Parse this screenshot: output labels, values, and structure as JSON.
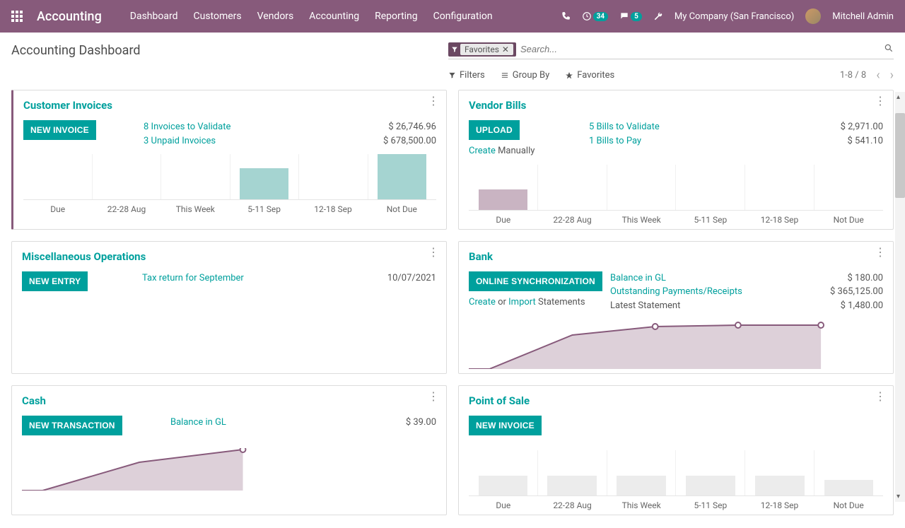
{
  "topbar": {
    "brand": "Accounting",
    "nav": [
      "Dashboard",
      "Customers",
      "Vendors",
      "Accounting",
      "Reporting",
      "Configuration"
    ],
    "activity_count": "34",
    "msg_count": "5",
    "company": "My Company (San Francisco)",
    "user": "Mitchell Admin"
  },
  "header": {
    "title": "Accounting Dashboard",
    "filter_tag": "Favorites",
    "search_placeholder": "Search...",
    "tools": {
      "filters": "Filters",
      "groupby": "Group By",
      "favorites": "Favorites"
    },
    "pager": "1-8 / 8"
  },
  "cards": {
    "ci": {
      "title": "Customer Invoices",
      "button": "NEW INVOICE",
      "line1": "8 Invoices to Validate",
      "amt1": "$ 26,746.96",
      "line2": "3 Unpaid Invoices",
      "amt2": "$ 678,500.00"
    },
    "vb": {
      "title": "Vendor Bills",
      "button": "UPLOAD",
      "sub_create": "Create",
      "sub_manual": " Manually",
      "line1": "5 Bills to Validate",
      "amt1": "$ 2,971.00",
      "line2": "1 Bills to Pay",
      "amt2": "$ 541.10"
    },
    "mo": {
      "title": "Miscellaneous Operations",
      "button": "NEW ENTRY",
      "line1": "Tax return for September",
      "amt1": "10/07/2021"
    },
    "bank": {
      "title": "Bank",
      "button": "ONLINE SYNCHRONIZATION",
      "sub_create": "Create",
      "sub_or": " or ",
      "sub_import": "Import",
      "sub_stmt": " Statements",
      "l1": "Balance in GL",
      "a1": "$ 180.00",
      "l2": "Outstanding Payments/Receipts",
      "a2": "$ 365,125.00",
      "l3": "Latest Statement",
      "a3": "$ 1,480.00"
    },
    "cash": {
      "title": "Cash",
      "button": "NEW TRANSACTION",
      "l1": "Balance in GL",
      "a1": "$ 39.00"
    },
    "pos": {
      "title": "Point of Sale",
      "button": "NEW INVOICE"
    }
  },
  "xcats": [
    "Due",
    "22-28 Aug",
    "This Week",
    "5-11 Sep",
    "12-18 Sep",
    "Not Due"
  ],
  "chart_data": [
    {
      "type": "bar",
      "card": "ci",
      "categories": [
        "Due",
        "22-28 Aug",
        "This Week",
        "5-11 Sep",
        "12-18 Sep",
        "Not Due"
      ],
      "values": [
        0,
        0,
        0,
        44,
        0,
        64
      ],
      "color": "teal"
    },
    {
      "type": "bar",
      "card": "vb",
      "categories": [
        "Due",
        "22-28 Aug",
        "This Week",
        "5-11 Sep",
        "12-18 Sep",
        "Not Due"
      ],
      "values": [
        28,
        0,
        0,
        0,
        0,
        0
      ],
      "color": "mauve"
    },
    {
      "type": "line",
      "card": "bank",
      "x": [
        "Due",
        "22-28 Aug",
        "This Week",
        "5-11 Sep",
        "12-18 Sep",
        "Not Due"
      ],
      "values": [
        0,
        48,
        60,
        62,
        62,
        62
      ]
    },
    {
      "type": "line",
      "card": "cash",
      "x": [
        "Due",
        "22-28 Aug",
        "This Week",
        "5-11 Sep",
        "12-18 Sep",
        "Not Due"
      ],
      "values": [
        0,
        40,
        62,
        62,
        62,
        62
      ]
    },
    {
      "type": "bar",
      "card": "pos",
      "categories": [
        "Due",
        "22-28 Aug",
        "This Week",
        "5-11 Sep",
        "12-18 Sep",
        "Not Due"
      ],
      "values": [
        28,
        28,
        28,
        28,
        28,
        22
      ],
      "color": "grey"
    }
  ]
}
